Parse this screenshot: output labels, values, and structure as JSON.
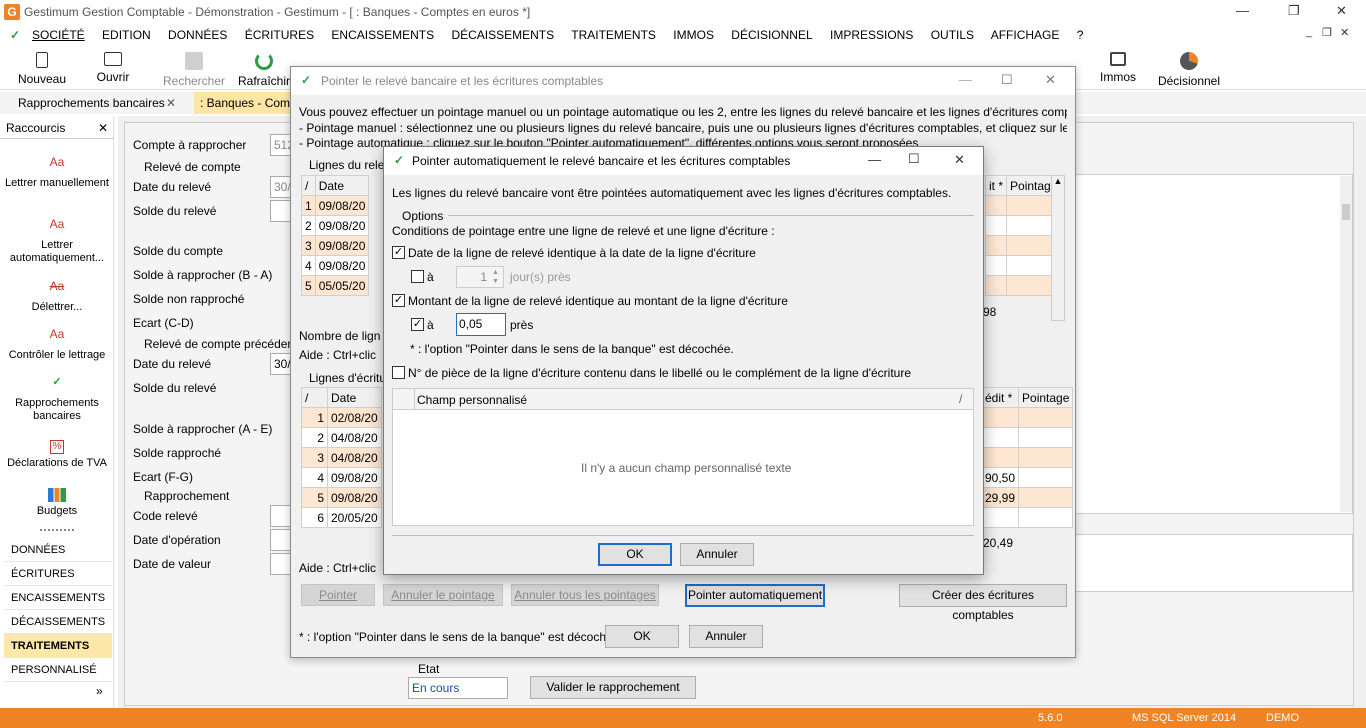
{
  "app": {
    "title": "Gestimum Gestion Comptable - Démonstration - Gestimum - [ : Banques - Comptes en euros *]",
    "logo_letter": "G",
    "win_min": "—",
    "win_restore": "❐",
    "win_close": "✕"
  },
  "menu": [
    "SOCIÉTÉ",
    "EDITION",
    "DONNÉES",
    "ÉCRITURES",
    "ENCAISSEMENTS",
    "DÉCAISSEMENTS",
    "TRAITEMENTS",
    "IMMOS",
    "DÉCISIONNEL",
    "IMPRESSIONS",
    "OUTILS",
    "AFFICHAGE",
    "?"
  ],
  "toolbar": {
    "nouveau": "Nouveau",
    "ouvrir": "Ouvrir",
    "rechercher": "Rechercher",
    "rafraichir": "Rafraîchir",
    "immos": "Immos",
    "decisionnel": "Décisionnel"
  },
  "tabs": {
    "rapprochements": "Rapprochements bancaires",
    "banques": ": Banques - Com",
    "close": "✕"
  },
  "sidebar": {
    "title": "Raccourcis",
    "close": "✕",
    "items": [
      "Lettrer manuellement",
      "Lettrer automatiquement...",
      "Délettrer...",
      "Contrôler le lettrage",
      "Rapprochements bancaires",
      "Déclarations de TVA",
      "Budgets"
    ],
    "nav": [
      "DONNÉES",
      "ÉCRITURES",
      "ENCAISSEMENTS",
      "DÉCAISSEMENTS",
      "TRAITEMENTS",
      "PERSONNALISÉ"
    ],
    "more": "»"
  },
  "form": {
    "compte_label": "Compte à rapprocher",
    "compte_value": "512",
    "releve_section": "Relevé de compte",
    "date_releve": "Date du relevé",
    "date_releve_value": "30/",
    "solde_releve": "Solde du relevé",
    "solde_compte": "Solde du compte",
    "solde_a_rapprocher_ba": "Solde à rapprocher (B - A)",
    "solde_non_rapproche": "Solde non rapproché",
    "ecart_cd": "Ecart (C-D)",
    "releve_precedent": "Relevé de compte précéden",
    "date_releve_prec_value": "30/",
    "solde_a_rapprocher_ae": "Solde à rapprocher (A - E)",
    "solde_rapproche": "Solde rapproché",
    "ecart_fg": "Ecart (F-G)",
    "rapprochement_section": "Rapprochement",
    "code_releve": "Code relevé",
    "date_operation": "Date d'opération",
    "date_valeur": "Date de valeur",
    "etat_label": "Etat",
    "etat_value": "En cours",
    "valider": "Valider le rapprochement"
  },
  "dialog1": {
    "title": "Pointer le relevé bancaire et les écritures comptables",
    "intro1": "Vous pouvez effectuer un pointage manuel ou un pointage automatique ou les 2, entre les lignes du relevé bancaire et les lignes d'écritures compt",
    "intro2": "- Pointage manuel : sélectionnez une ou plusieurs lignes du relevé bancaire, puis une ou plusieurs lignes d'écritures comptables, et cliquez sur le b",
    "intro3": "- Pointage automatique : cliquez sur le bouton \"Pointer automatiquement\", différentes options vous seront proposées",
    "lignes_releve": "Lignes du rele",
    "grid1_header": [
      "/",
      "Date"
    ],
    "grid1_rows": [
      [
        "1",
        "09/08/20"
      ],
      [
        "2",
        "09/08/20"
      ],
      [
        "3",
        "09/08/20"
      ],
      [
        "4",
        "09/08/20"
      ],
      [
        "5",
        "05/05/20"
      ]
    ],
    "grid1_right_header": [
      "it *",
      "Pointage"
    ],
    "grid1_total": "98",
    "nombre_lignes": "Nombre de lign",
    "aide1": "Aide : Ctrl+clic",
    "lignes_ecritures": "Lignes d'écritu",
    "grid2_header": [
      "/",
      "Date"
    ],
    "grid2_rows": [
      [
        "1",
        "02/08/20"
      ],
      [
        "2",
        "04/08/20"
      ],
      [
        "3",
        "04/08/20"
      ],
      [
        "4",
        "09/08/20"
      ],
      [
        "5",
        "09/08/20"
      ],
      [
        "6",
        "20/05/20"
      ]
    ],
    "grid2_right_header": [
      "édit *",
      "Pointage"
    ],
    "grid2_credit": [
      "",
      "",
      "",
      "90,50",
      "29,99",
      ""
    ],
    "grid2_total": "20,49",
    "aide2": "Aide : Ctrl+clic",
    "btn_pointer": "Pointer",
    "btn_annuler_pointage": "Annuler le pointage",
    "btn_annuler_tous": "Annuler tous les pointages",
    "btn_pointer_auto": "Pointer automatiquement",
    "btn_creer": "Créer des écritures comptables",
    "footnote": "* : l'option \"Pointer dans le sens de la banque\" est décoché",
    "ok": "OK",
    "annuler": "Annuler"
  },
  "dialog2": {
    "title": "Pointer automatiquement le relevé bancaire et les écritures comptables",
    "intro": "Les lignes du relevé bancaire vont être pointées automatiquement avec les lignes d'écritures comptables.",
    "options": "Options",
    "conditions": "Conditions de pointage entre une ligne de relevé et une ligne d'écriture :",
    "opt_date": "Date de la ligne de relevé identique à la date de la ligne d'écriture",
    "opt_date_checked": true,
    "a_label": "à",
    "jours_value": "1",
    "jours_suffix": "jour(s) près",
    "opt_montant": "Montant de la ligne de relevé identique au montant de la ligne d'écriture",
    "opt_montant_checked": true,
    "montant_value": "0,05",
    "pres": "près",
    "note": "* : l'option \"Pointer dans le sens de la banque\" est décochée.",
    "opt_piece": "N° de pièce de la ligne d'écriture contenu dans le libellé ou le complément de la ligne d'écriture",
    "champ_header": "Champ personnalisé",
    "empty": "Il n'y a aucun champ personnalisé texte",
    "ok": "OK",
    "annuler": "Annuler"
  },
  "status": {
    "version": "5.6.0",
    "server": "MS SQL Server 2014",
    "db": "DEMO"
  },
  "colors": {
    "accent": "#f08323",
    "highlight": "#fde6d2",
    "selected_nav": "#fde7a9"
  }
}
